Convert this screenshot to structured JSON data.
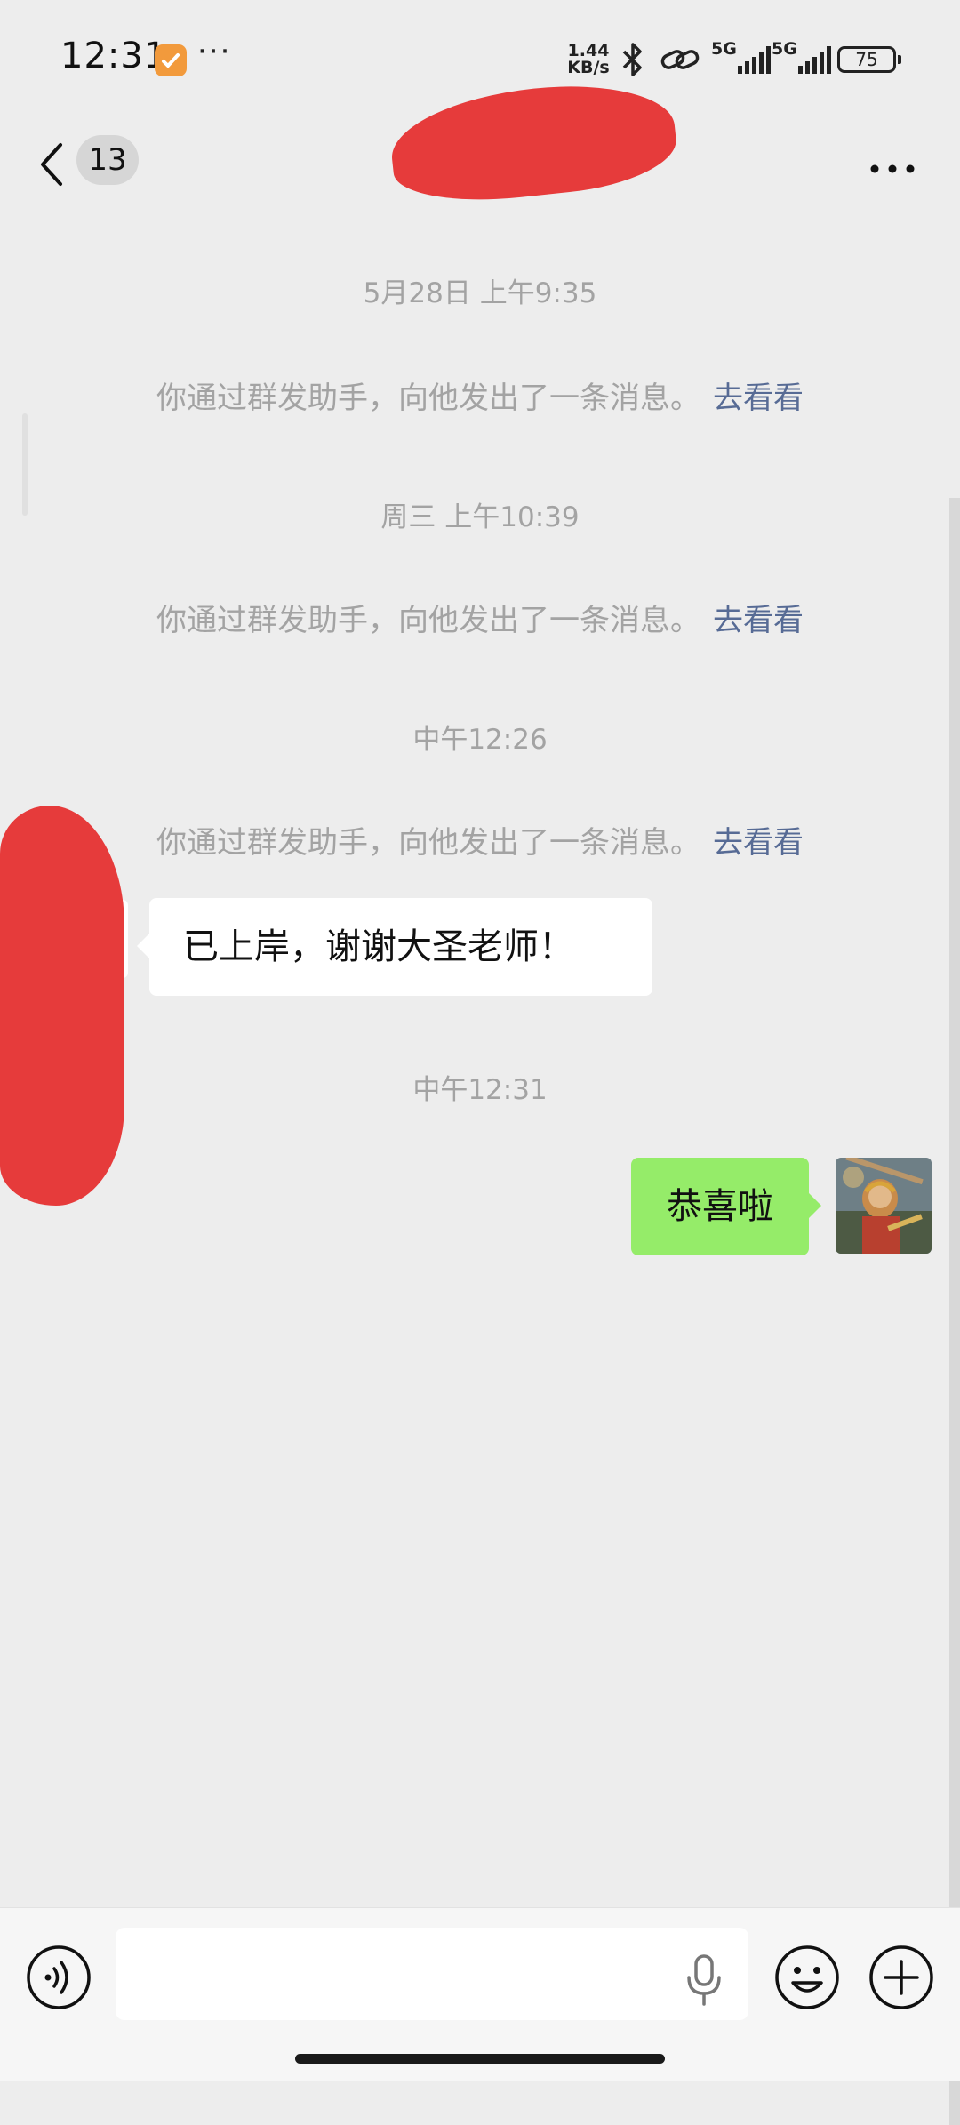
{
  "status_bar": {
    "time": "12:31",
    "dots": "···",
    "net_speed_value": "1.44",
    "net_speed_unit": "KB/s",
    "network_1": "5G",
    "network_2": "5G",
    "battery": "75"
  },
  "header": {
    "unread_count": "13"
  },
  "messages": {
    "ts_1": "5月28日 上午9:35",
    "notice_1": "你通过群发助手，向他发出了一条消息。",
    "link_1": "去看看",
    "ts_2": "周三 上午10:39",
    "notice_2": "你通过群发助手，向他发出了一条消息。",
    "link_2": "去看看",
    "ts_3": "中午12:26",
    "notice_3": "你通过群发助手，向他发出了一条消息。",
    "link_3": "去看看",
    "incoming_text": "已上岸，谢谢大圣老师！",
    "ts_4": "中午12:31",
    "outgoing_text": "恭喜啦"
  },
  "input_bar": {
    "message_value": ""
  },
  "colors": {
    "background": "#ededed",
    "outgoing_bubble": "#95ec69",
    "incoming_bubble": "#ffffff",
    "link": "#576b95",
    "redaction": "#e63b3b"
  }
}
